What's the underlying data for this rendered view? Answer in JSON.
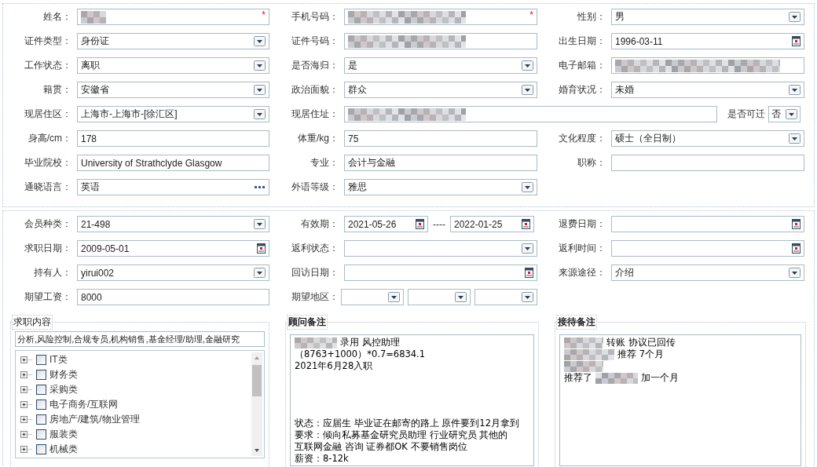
{
  "profile": {
    "rows": [
      [
        {
          "label": "姓名：",
          "kind": "text",
          "blurred": true,
          "required_mark": "*"
        },
        {
          "label": "手机号码：",
          "kind": "text",
          "blurred": true,
          "required_mark": "*"
        },
        {
          "label": "性别：",
          "kind": "select",
          "value": "男"
        }
      ],
      [
        {
          "label": "证件类型：",
          "kind": "select",
          "value": "身份证"
        },
        {
          "label": "证件号码：",
          "kind": "text",
          "blurred": true
        },
        {
          "label": "出生日期：",
          "kind": "date",
          "value": "1996-03-11"
        }
      ],
      [
        {
          "label": "工作状态：",
          "kind": "select",
          "value": "离职"
        },
        {
          "label": "是否海归：",
          "kind": "select",
          "value": "是"
        },
        {
          "label": "电子邮箱：",
          "kind": "text",
          "blurred": true
        }
      ],
      [
        {
          "label": "籍贯：",
          "kind": "select",
          "value": "安徽省"
        },
        {
          "label": "政治面貌：",
          "kind": "select",
          "value": "群众"
        },
        {
          "label": "婚育状况：",
          "kind": "select",
          "value": "未婚"
        }
      ],
      [
        {
          "label": "现居住区：",
          "kind": "select",
          "value": "上海市-上海市-[徐汇区]"
        },
        {
          "label": "现居住址：",
          "kind": "text",
          "blurred": true
        },
        {
          "label": "是否可迁",
          "kind": "mini_select",
          "value": "否"
        }
      ],
      [
        {
          "label": "身高/cm：",
          "kind": "text",
          "value": "178"
        },
        {
          "label": "体重/kg：",
          "kind": "text",
          "value": "75"
        },
        {
          "label": "文化程度：",
          "kind": "select",
          "value": "硕士（全日制）"
        }
      ],
      [
        {
          "label": "毕业院校：",
          "kind": "text",
          "value": "University of Strathclyde Glasgow"
        },
        {
          "label": "专业：",
          "kind": "text",
          "value": "会计与金融"
        },
        {
          "label": "职称：",
          "kind": "text"
        }
      ],
      [
        {
          "label": "通晓语言：",
          "kind": "lookup",
          "value": "英语"
        },
        {
          "label": "外语等级：",
          "kind": "select",
          "value": "雅思"
        }
      ]
    ]
  },
  "membership": {
    "rows": [
      [
        {
          "label": "会员种类：",
          "kind": "select",
          "value": "21-498"
        },
        {
          "label": "有效期：",
          "kind": "daterange",
          "from": "2021-05-26",
          "separator": "----",
          "to": "2022-01-25"
        },
        {
          "label": "退费日期：",
          "kind": "date"
        }
      ],
      [
        {
          "label": "求职日期：",
          "kind": "date",
          "value": "2009-05-01"
        },
        {
          "label": "返利状态：",
          "kind": "select"
        },
        {
          "label": "返利时间：",
          "kind": "date"
        }
      ],
      [
        {
          "label": "持有人：",
          "kind": "select",
          "value": "yirui002"
        },
        {
          "label": "回访日期：",
          "kind": "date"
        },
        {
          "label": "来源途径：",
          "kind": "select",
          "value": "介绍"
        }
      ],
      [
        {
          "label": "期望工资：",
          "kind": "text",
          "value": "8000"
        },
        {
          "label": "期望地区：",
          "kind": "multi_select",
          "selects": [
            {
              "kind": "select"
            },
            {
              "kind": "select"
            },
            {
              "kind": "select"
            }
          ]
        }
      ]
    ]
  },
  "job_content": {
    "title": "求职内容",
    "summary": "分析,风险控制,合规专员,机构销售,基金经理/助理,金融研究",
    "tree": [
      {
        "label": "IT类",
        "expanded": false,
        "checked": false
      },
      {
        "label": "财务类",
        "expanded": false,
        "checked": false
      },
      {
        "label": "采购类",
        "expanded": false,
        "checked": false
      },
      {
        "label": "电子商务/互联网",
        "expanded": false,
        "checked": false
      },
      {
        "label": "房地产/建筑/物业管理",
        "expanded": false,
        "checked": false
      },
      {
        "label": "服装类",
        "expanded": false,
        "checked": false
      },
      {
        "label": "机械类",
        "expanded": false,
        "checked": false
      }
    ]
  },
  "advisor_notes": {
    "title": "顾问备注",
    "paragraphs": [
      [
        [
          {
            "kind": "blur"
          },
          {
            "kind": "text",
            "text": "录用    风控助理"
          }
        ],
        [
          {
            "kind": "text",
            "text": "（8763+1000）*0.7=6834.1"
          }
        ],
        [
          {
            "kind": "text",
            "text": "2021年6月28入职"
          }
        ]
      ],
      [
        [
          {
            "kind": "text",
            "text": "状态：应届生  毕业证在邮寄的路上 原件要到12月拿到"
          }
        ],
        [
          {
            "kind": "text",
            "text": "要求：倾向私募基金研究员助理  行业研究员  其他的"
          }
        ],
        [
          {
            "kind": "text",
            "text": "互联网金融  咨询  证券都OK 不要销售岗位"
          }
        ],
        [
          {
            "kind": "text",
            "text": "薪资：8-12k"
          }
        ]
      ]
    ]
  },
  "reception_notes": {
    "title": "接待备注",
    "paragraphs": [
      [
        [
          {
            "kind": "blur"
          },
          {
            "kind": "text",
            "text": "转账 协议已回传"
          }
        ],
        [
          {
            "kind": "blur"
          },
          {
            "kind": "text",
            "text": "推荐 7个月"
          }
        ],
        [
          {
            "kind": "blur"
          }
        ],
        [
          {
            "kind": "text",
            "text": "推荐了"
          },
          {
            "kind": "blur"
          },
          {
            "kind": "text",
            "text": "加一个月"
          }
        ]
      ]
    ]
  }
}
